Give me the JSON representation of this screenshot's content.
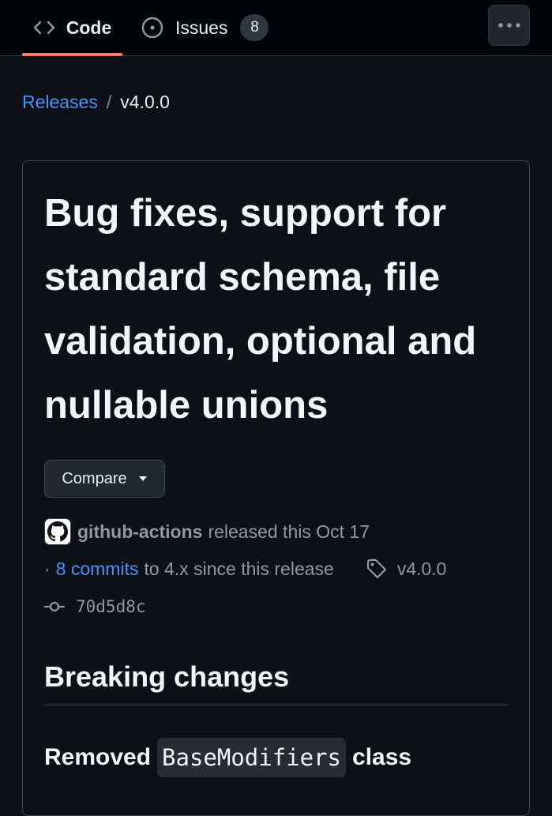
{
  "nav": {
    "tabs": [
      {
        "label": "Code",
        "icon": "code-icon",
        "active": true
      },
      {
        "label": "Issues",
        "icon": "issue-opened-icon",
        "count": "8"
      }
    ],
    "more_icon": "kebab-horizontal-icon"
  },
  "breadcrumb": {
    "parent": "Releases",
    "separator": "/",
    "current": "v4.0.0"
  },
  "release": {
    "title": "Bug fixes, support for standard schema, file validation, optional and nullable unions",
    "compare_label": "Compare",
    "author": "github-actions",
    "released_text": "released this Oct 17",
    "commits_prefix": "·",
    "commits_link": "8 commits",
    "commits_suffix": "to 4.x since this release",
    "tag": "v4.0.0",
    "commit_sha": "70d5d8c"
  },
  "body": {
    "heading": "Breaking changes",
    "subheading_before": "Removed",
    "subheading_code": "BaseModifiers",
    "subheading_after": "class"
  },
  "colors": {
    "background": "#0d1117",
    "nav_background": "#010409",
    "accent_underline": "#f78166",
    "link": "#4493f8",
    "muted_text": "#9198a1"
  }
}
